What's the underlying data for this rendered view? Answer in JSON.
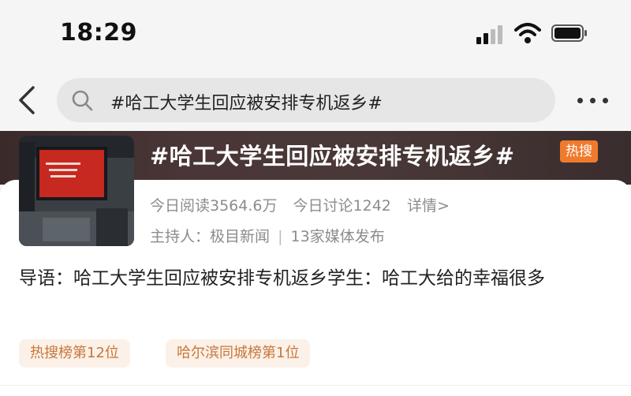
{
  "status_bar": {
    "time": "18:29"
  },
  "search": {
    "query": "#哈工大学生回应被安排专机返乡#"
  },
  "topic": {
    "title": "#哈工大学生回应被安排专机返乡#",
    "hot_badge": "热搜",
    "reads": "今日阅读3564.6万",
    "discussions": "今日讨论1242",
    "details": "详情>",
    "host_label": "主持人：极目新闻",
    "separator": "|",
    "media": "13家媒体发布",
    "intro": "导语：哈工大学生回应被安排专机返乡学生：哈工大给的幸福很多"
  },
  "tags": [
    {
      "label": "热搜榜第12位"
    },
    {
      "label": "哈尔滨同城榜第1位"
    }
  ],
  "colors": {
    "accent": "#f07a2c",
    "tag_text": "#c8763a",
    "tag_bg": "#fbf1e8",
    "banner": "#4a3636"
  },
  "icons": [
    "back-arrow-icon",
    "search-icon",
    "more-dots-icon",
    "signal-icon",
    "wifi-icon",
    "battery-icon"
  ]
}
